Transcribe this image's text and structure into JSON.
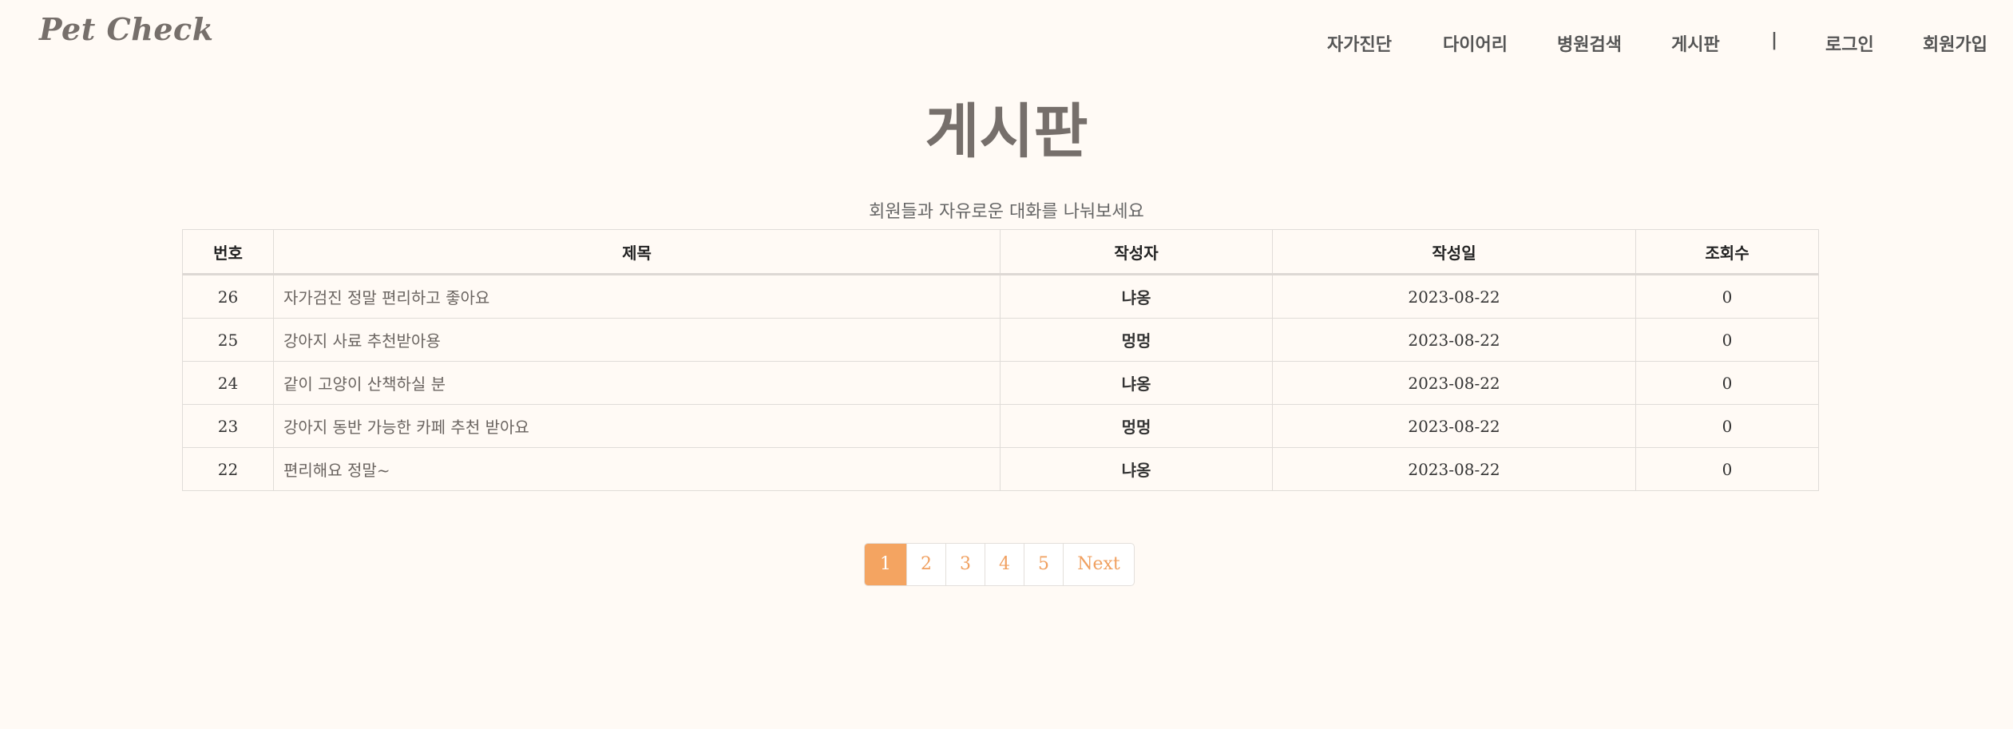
{
  "header": {
    "logo": "Pet Check",
    "nav": [
      {
        "label": "자가진단"
      },
      {
        "label": "다이어리"
      },
      {
        "label": "병원검색"
      },
      {
        "label": "게시판"
      },
      {
        "label": "|"
      },
      {
        "label": "로그인"
      },
      {
        "label": "회원가입"
      }
    ]
  },
  "board": {
    "title": "게시판",
    "subtitle": "회원들과 자유로운 대화를 나눠보세요",
    "columns": [
      "번호",
      "제목",
      "작성자",
      "작성일",
      "조회수"
    ],
    "rows": [
      {
        "no": "26",
        "title": "자가검진 정말 편리하고 좋아요",
        "author": "냐옹",
        "date": "2023-08-22",
        "views": "0"
      },
      {
        "no": "25",
        "title": "강아지 사료 추천받아용",
        "author": "멍멍",
        "date": "2023-08-22",
        "views": "0"
      },
      {
        "no": "24",
        "title": "같이 고양이 산책하실 분",
        "author": "냐옹",
        "date": "2023-08-22",
        "views": "0"
      },
      {
        "no": "23",
        "title": "강아지 동반 가능한 카페 추천 받아요",
        "author": "멍멍",
        "date": "2023-08-22",
        "views": "0"
      },
      {
        "no": "22",
        "title": "편리해요 정말~",
        "author": "냐옹",
        "date": "2023-08-22",
        "views": "0"
      }
    ]
  },
  "pagination": {
    "pages": [
      "1",
      "2",
      "3",
      "4",
      "5"
    ],
    "active": "1",
    "next_label": "Next"
  },
  "colors": {
    "background": "#fffaf5",
    "accent": "#f4a461",
    "title": "#766f6b"
  }
}
